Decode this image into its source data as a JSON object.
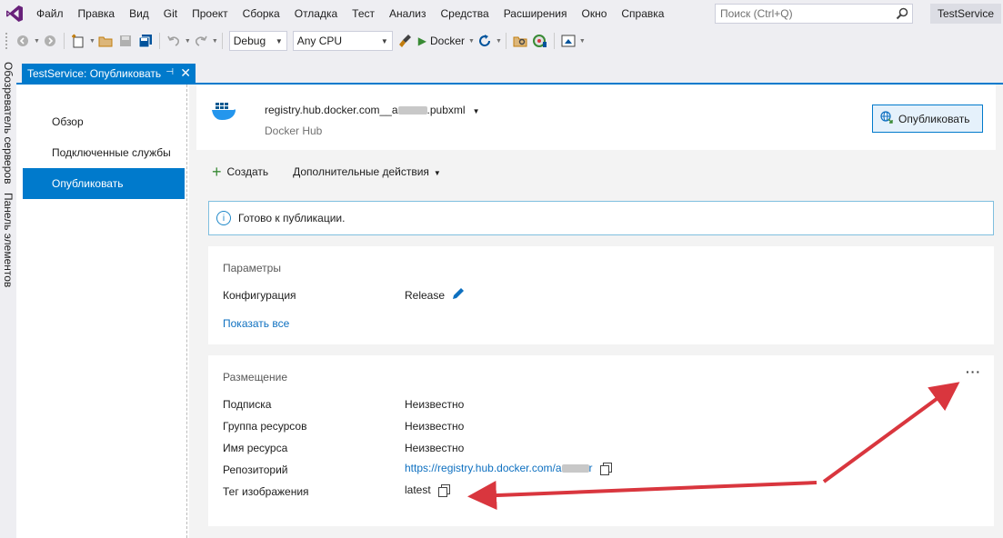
{
  "menu": {
    "items": [
      "Файл",
      "Правка",
      "Вид",
      "Git",
      "Проект",
      "Сборка",
      "Отладка",
      "Тест",
      "Анализ",
      "Средства",
      "Расширения",
      "Окно",
      "Справка"
    ],
    "search_placeholder": "Поиск (Ctrl+Q)",
    "solution_name": "TestService"
  },
  "toolbar": {
    "configuration": "Debug",
    "platform": "Any CPU",
    "run_target": "Docker"
  },
  "side_panels": {
    "server_explorer": "Обозреватель серверов",
    "toolbox": "Панель элементов"
  },
  "document_tab": {
    "title": "TestService: Опубликовать"
  },
  "nav": {
    "items": [
      {
        "label": "Обзор",
        "active": false
      },
      {
        "label": "Подключенные службы",
        "active": false
      },
      {
        "label": "Опубликовать",
        "active": true
      }
    ]
  },
  "profile": {
    "name_prefix": "registry.hub.docker.com__a",
    "name_suffix": ".pubxml",
    "provider": "Docker Hub",
    "publish_label": "Опубликовать"
  },
  "actions": {
    "create_label": "Создать",
    "more_label": "Дополнительные действия"
  },
  "info": {
    "message": "Готово к публикации."
  },
  "parameters": {
    "title": "Параметры",
    "config_label": "Конфигурация",
    "config_value": "Release",
    "show_all_label": "Показать все"
  },
  "hosting": {
    "title": "Размещение",
    "subscription_label": "Подписка",
    "subscription_value": "Неизвестно",
    "resource_group_label": "Группа ресурсов",
    "resource_group_value": "Неизвестно",
    "resource_name_label": "Имя ресурса",
    "resource_name_value": "Неизвестно",
    "repository_label": "Репозиторий",
    "repository_prefix": "https://registry.hub.docker.com/a",
    "repository_suffix": "r",
    "image_tag_label": "Тег изображения",
    "image_tag_value": "latest",
    "more_options": "···"
  },
  "colors": {
    "accent": "#007acc",
    "annotation_arrow": "#d9363e",
    "link": "#0e70c0"
  }
}
